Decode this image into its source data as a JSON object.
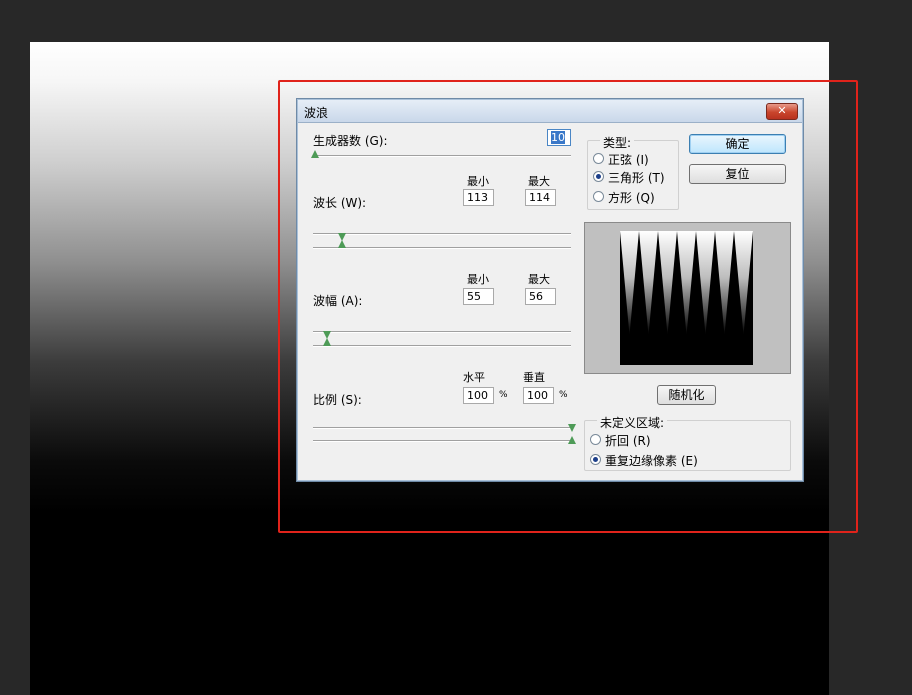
{
  "dialog": {
    "title": "波浪",
    "close_glyph": "✕",
    "generators": {
      "label": "生成器数 (G):",
      "value": "10",
      "slider_fraction": 0.0
    },
    "wavelength": {
      "label": "波长 (W):",
      "min_label": "最小",
      "max_label": "最大",
      "min": "113",
      "max": "114"
    },
    "amplitude": {
      "label": "波幅 (A):",
      "min_label": "最小",
      "max_label": "最大",
      "min": "55",
      "max": "56"
    },
    "scale": {
      "label": "比例 (S):",
      "h_label": "水平",
      "v_label": "垂直",
      "h": "100",
      "v": "100",
      "unit": "%"
    },
    "type": {
      "title": "类型:",
      "options": [
        {
          "label": "正弦 (I)",
          "selected": false
        },
        {
          "label": "三角形 (T)",
          "selected": true
        },
        {
          "label": "方形 (Q)",
          "selected": false
        }
      ]
    },
    "buttons": {
      "ok": "确定",
      "reset": "复位",
      "randomize": "随机化"
    },
    "undefined_area": {
      "title": "未定义区域:",
      "options": [
        {
          "label": "折回 (R)",
          "selected": false
        },
        {
          "label": "重复边缘像素 (E)",
          "selected": true
        }
      ]
    }
  }
}
